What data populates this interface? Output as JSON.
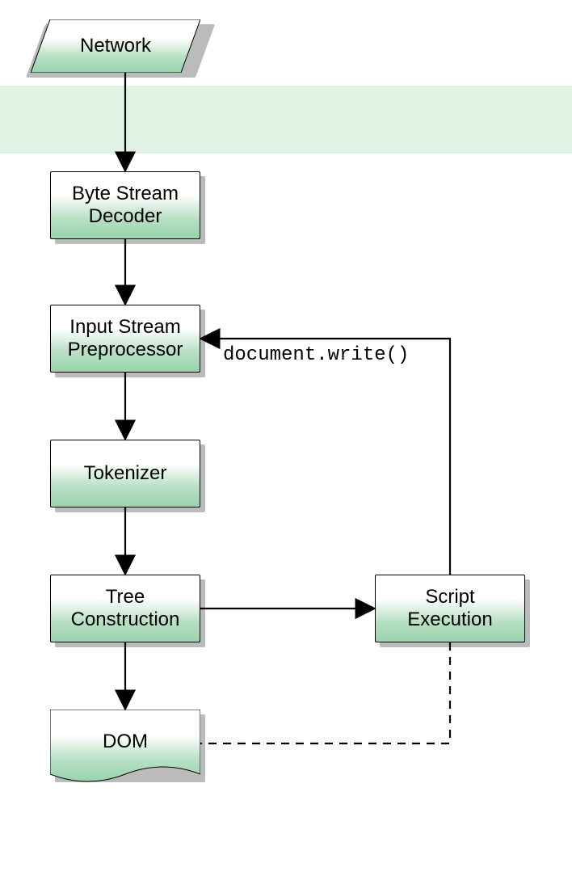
{
  "diagram": {
    "nodes": {
      "network": {
        "label": "Network"
      },
      "decoder": {
        "label": "Byte Stream\nDecoder"
      },
      "preproc": {
        "label": "Input Stream\nPreprocessor"
      },
      "tokenizer": {
        "label": "Tokenizer"
      },
      "tree": {
        "label": "Tree\nConstruction"
      },
      "script": {
        "label": "Script\nExecution"
      },
      "dom": {
        "label": "DOM"
      }
    },
    "edges": {
      "docwrite_label": "document.write()"
    },
    "colors": {
      "node_fill_top": "#ffffff",
      "node_fill_bottom": "#98d3ab",
      "band": "#e0f2e4",
      "stroke": "#000000"
    }
  }
}
